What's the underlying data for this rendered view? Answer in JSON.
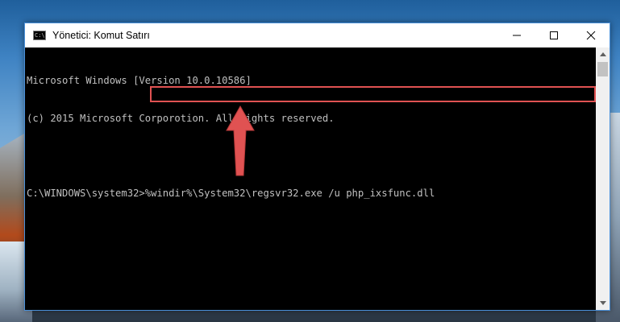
{
  "window": {
    "title": "Yönetici: Komut Satırı",
    "icon_label": "C:\\",
    "controls": {
      "minimize": "–",
      "maximize": "☐",
      "close": "✕"
    }
  },
  "console": {
    "lines": [
      "Microsoft Windows [Version 10.0.10586]",
      "(c) 2015 Microsoft Corporotion. All rights reserved.",
      "",
      "C:\\WINDOWS\\system32>%windir%\\System32\\regsvr32.exe /u php_ixsfunc.dll"
    ]
  },
  "colors": {
    "highlight": "#e05252",
    "arrow": "#e05252",
    "console_text": "#c0c0c0",
    "console_bg": "#000000"
  },
  "icons": {
    "app": "cmd-icon",
    "arrow": "up-arrow-icon"
  }
}
